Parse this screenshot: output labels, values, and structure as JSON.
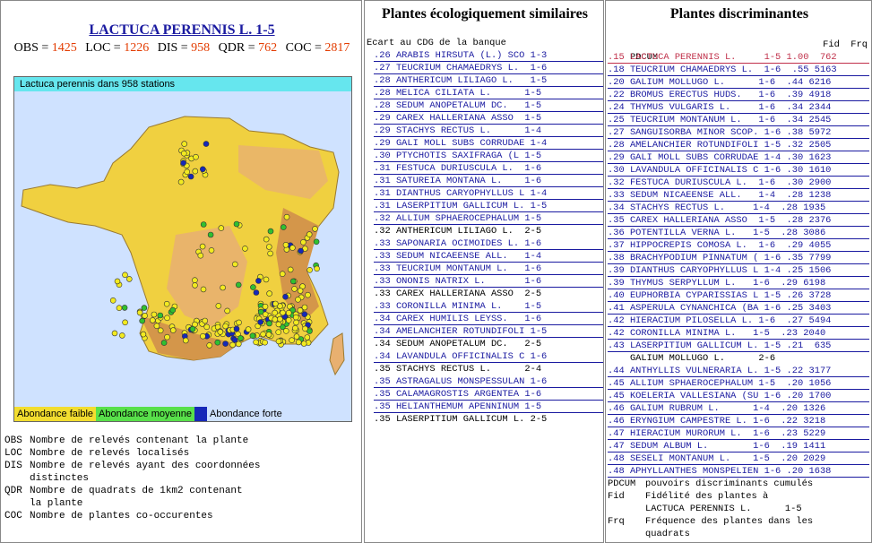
{
  "left": {
    "title": "LACTUCA PERENNIS L. 1-5",
    "stats": [
      {
        "key": "OBS",
        "value": "1425"
      },
      {
        "key": "LOC",
        "value": "1226"
      },
      {
        "key": "DIS",
        "value": "958"
      },
      {
        "key": "QDR",
        "value": "762"
      },
      {
        "key": "COC",
        "value": "2817"
      }
    ],
    "map_caption": "Lactuca perennis dans 958 stations",
    "legend": [
      "Abondance faible",
      "Abondance moyenne",
      "",
      "Abondance forte"
    ],
    "colors": {
      "land_high": "#e8b070",
      "land_mid": "#f0d040",
      "sea": "#cfe2ff",
      "dot_yellow": "#f2ea20",
      "dot_green": "#30c030",
      "dot_blue": "#1628b8"
    },
    "definitions": [
      {
        "abbr": "OBS",
        "text": "Nombre de relevés contenant la plante"
      },
      {
        "abbr": "LOC",
        "text": "Nombre de relevés localisés"
      },
      {
        "abbr": "DIS",
        "text": "Nombre de relevés ayant des coordonnées\ndistinctes"
      },
      {
        "abbr": "QDR",
        "text": "Nombre de quadrats de 1km2 contenant\nla plante"
      },
      {
        "abbr": "COC",
        "text": "Nombre de plantes co-occurentes"
      }
    ]
  },
  "middle": {
    "title": "Plantes écologiquement similaires",
    "subtitle": "Ecart au CDG de la banque",
    "rows": [
      {
        "text": ".26 ARABIS HIRSUTA (L.) SCO 1-3",
        "link": true
      },
      {
        "text": ".27 TEUCRIUM CHAMAEDRYS L.  1-6",
        "link": true
      },
      {
        "text": ".28 ANTHERICUM LILIAGO L.   1-5",
        "link": true
      },
      {
        "text": ".28 MELICA CILIATA L.      1-5",
        "link": true
      },
      {
        "text": ".28 SEDUM ANOPETALUM DC.   1-5",
        "link": true
      },
      {
        "text": ".29 CAREX HALLERIANA ASSO  1-5",
        "link": true
      },
      {
        "text": ".29 STACHYS RECTUS L.      1-4",
        "link": true
      },
      {
        "text": ".29 GALI MOLL SUBS CORRUDAE 1-4",
        "link": true
      },
      {
        "text": ".30 PTYCHOTIS SAXIFRAGA (L 1-5",
        "link": true
      },
      {
        "text": ".31 FESTUCA DURIUSCULA L.  1-6",
        "link": true
      },
      {
        "text": ".31 SATUREIA MONTANA L.    1-6",
        "link": true
      },
      {
        "text": ".31 DIANTHUS CARYOPHYLLUS L 1-4",
        "link": true
      },
      {
        "text": ".31 LASERPITIUM GALLICUM L. 1-5",
        "link": true
      },
      {
        "text": ".32 ALLIUM SPHAEROCEPHALUM 1-5",
        "link": true
      },
      {
        "text": ".32 ANTHERICUM LILIAGO L.  2-5",
        "link": false
      },
      {
        "text": ".33 SAPONARIA OCIMOIDES L. 1-6",
        "link": true
      },
      {
        "text": ".33 SEDUM NICAEENSE ALL.   1-4",
        "link": true
      },
      {
        "text": ".33 TEUCRIUM MONTANUM L.   1-6",
        "link": true
      },
      {
        "text": ".33 ONONIS NATRIX L.       1-6",
        "link": true
      },
      {
        "text": ".33 CAREX HALLERIANA ASSO  2-5",
        "link": false
      },
      {
        "text": ".33 CORONILLA MINIMA L.    1-5",
        "link": true
      },
      {
        "text": ".34 CAREX HUMILIS LEYSS.   1-6",
        "link": true
      },
      {
        "text": ".34 AMELANCHIER ROTUNDIFOLI 1-5",
        "link": true
      },
      {
        "text": ".34 SEDUM ANOPETALUM DC.   2-5",
        "link": false
      },
      {
        "text": ".34 LAVANDULA OFFICINALIS C 1-6",
        "link": true
      },
      {
        "text": ".35 STACHYS RECTUS L.      2-4",
        "link": false
      },
      {
        "text": ".35 ASTRAGALUS MONSPESSULAN 1-6",
        "link": true
      },
      {
        "text": ".35 CALAMAGROSTIS ARGENTEA 1-6",
        "link": true
      },
      {
        "text": ".35 HELIANTHEMUM APENNINUM 1-5",
        "link": true
      },
      {
        "text": ".35 LASERPITIUM GALLICUM L. 2-5",
        "link": false
      }
    ]
  },
  "right": {
    "title": "Plantes discriminantes",
    "header_left": "PDCUM",
    "header_right": "Fid  Frq",
    "rows": [
      {
        "text": ".15 LACTUCA PERENNIS L.     1-5 1.00  762",
        "style": "sel"
      },
      {
        "text": ".18 TEUCRIUM CHAMAEDRYS L.  1-6  .55 5163",
        "style": "link"
      },
      {
        "text": ".20 GALIUM MOLLUGO L.      1-6  .44 6216",
        "style": "link"
      },
      {
        "text": ".22 BROMUS ERECTUS HUDS.   1-6  .39 4918",
        "style": "link"
      },
      {
        "text": ".24 THYMUS VULGARIS L.     1-6  .34 2344",
        "style": "link"
      },
      {
        "text": ".25 TEUCRIUM MONTANUM L.   1-6  .34 2545",
        "style": "link"
      },
      {
        "text": ".27 SANGUISORBA MINOR SCOP. 1-6 .38 5972",
        "style": "link"
      },
      {
        "text": ".28 AMELANCHIER ROTUNDIFOLI 1-5 .32 2505",
        "style": "link"
      },
      {
        "text": ".29 GALI MOLL SUBS CORRUDAE 1-4 .30 1623",
        "style": "link"
      },
      {
        "text": ".30 LAVANDULA OFFICINALIS C 1-6 .30 1610",
        "style": "link"
      },
      {
        "text": ".32 FESTUCA DURIUSCULA L.  1-6  .30 2900",
        "style": "link"
      },
      {
        "text": ".33 SEDUM NICAEENSE ALL.   1-4  .28 1238",
        "style": "link"
      },
      {
        "text": ".34 STACHYS RECTUS L.     1-4  .28 1935",
        "style": "link"
      },
      {
        "text": ".35 CAREX HALLERIANA ASSO  1-5  .28 2376",
        "style": "link"
      },
      {
        "text": ".36 POTENTILLA VERNA L.   1-5  .28 3086",
        "style": "link"
      },
      {
        "text": ".37 HIPPOCREPIS COMOSA L.  1-6  .29 4055",
        "style": "link"
      },
      {
        "text": ".38 BRACHYPODIUM PINNATUM ( 1-6 .35 7799",
        "style": "link"
      },
      {
        "text": ".39 DIANTHUS CARYOPHYLLUS L 1-4 .25 1506",
        "style": "link"
      },
      {
        "text": ".39 THYMUS SERPYLLUM L.   1-6  .29 6198",
        "style": "link"
      },
      {
        "text": ".40 EUPHORBIA CYPARISSIAS L 1-5 .26 3728",
        "style": "link"
      },
      {
        "text": ".41 ASPERULA CYNANCHICA (BA 1-6 .25 3403",
        "style": "link"
      },
      {
        "text": ".42 HIERACIUM PILOSELLA L. 1-6  .27 5494",
        "style": "link"
      },
      {
        "text": ".42 CORONILLA MINIMA L.   1-5  .23 2040",
        "style": "link"
      },
      {
        "text": ".43 LASERPITIUM GALLICUM L. 1-5 .21  635",
        "style": "link"
      },
      {
        "text": "    GALIUM MOLLUGO L.      2-6",
        "style": "plain"
      },
      {
        "text": ".44 ANTHYLLIS VULNERARIA L. 1-5 .22 3177",
        "style": "link"
      },
      {
        "text": ".45 ALLIUM SPHAEROCEPHALUM 1-5  .20 1056",
        "style": "link"
      },
      {
        "text": ".45 KOELERIA VALLESIANA (SU 1-6 .20 1700",
        "style": "link"
      },
      {
        "text": ".46 GALIUM RUBRUM L.      1-4  .20 1326",
        "style": "link"
      },
      {
        "text": ".46 ERYNGIUM CAMPESTRE L. 1-6  .22 3218",
        "style": "link"
      },
      {
        "text": ".47 HIERACIUM MURORUM L.  1-6  .23 5229",
        "style": "link"
      },
      {
        "text": ".47 SEDUM ALBUM L.        1-6  .19 1411",
        "style": "link"
      },
      {
        "text": ".48 SESELI MONTANUM L.    1-5  .20 2029",
        "style": "link"
      },
      {
        "text": ".48 APHYLLANTHES MONSPELIEN 1-6 .20 1638",
        "style": "link"
      }
    ],
    "footer": [
      {
        "abbr": "PDCUM",
        "text": "pouvoirs discriminants cumulés"
      },
      {
        "abbr": "Fid",
        "text": "Fidélité des plantes à\nLACTUCA PERENNIS L.      1-5"
      },
      {
        "abbr": "Frq",
        "text": "Fréquence des plantes dans les\nquadrats"
      }
    ]
  }
}
